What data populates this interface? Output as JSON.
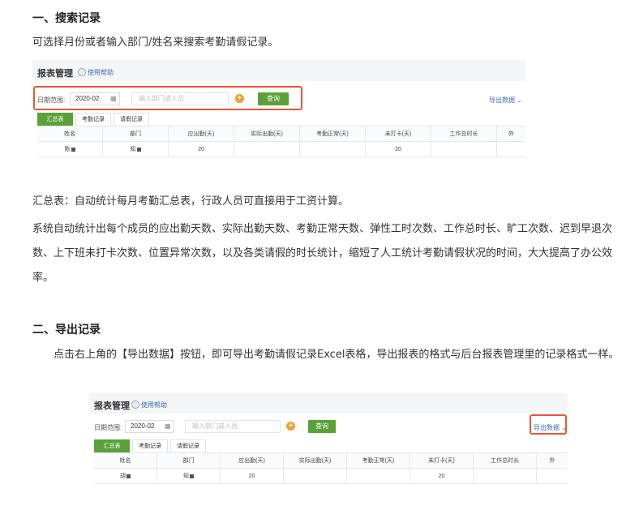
{
  "section1": {
    "heading": "一、搜索记录",
    "intro": "可选择月份或者输入部门/姓名来搜索考勤请假记录。"
  },
  "screenshot": {
    "title": "报表管理",
    "help": "使用帮助",
    "date_label": "日期范围:",
    "date_value": "2020-02",
    "search_placeholder": "输入部门或人员",
    "query_button": "查询",
    "export_button": "导出数据",
    "tabs": [
      "汇总表",
      "考勤记录",
      "请假记录"
    ],
    "columns": [
      "姓名",
      "部门",
      "应出勤(天)",
      "实际出勤(天)",
      "考勤正常(天)",
      "未打卡(天)",
      "工作总时长",
      "外"
    ],
    "row1": [
      "陈",
      "知",
      "20",
      "",
      "",
      "20",
      "",
      ""
    ],
    "row2": [
      "胡",
      "知",
      "20",
      "",
      "",
      "20",
      "",
      ""
    ]
  },
  "summary": {
    "p1": "汇总表：自动统计每月考勤汇总表，行政人员可直接用于工资计算。",
    "p2": "系统自动统计出每个成员的应出勤天数、实际出勤天数、考勤正常天数、弹性工时次数、工作总时长、旷工次数、迟到早退次数、上下班未打卡次数、位置异常次数，以及各类请假的时长统计，缩短了人工统计考勤请假状况的时间，大大提高了办公效率。"
  },
  "section2": {
    "heading": "二、导出记录",
    "intro": "点击右上角的【导出数据】按钮，即可导出考勤请假记录Excel表格，导出报表的格式与后台报表管理里的记录格式一样。"
  },
  "colors": {
    "accent_green": "#5aa13a",
    "highlight_red": "#e8563a",
    "link_blue": "#3b6bb3"
  }
}
